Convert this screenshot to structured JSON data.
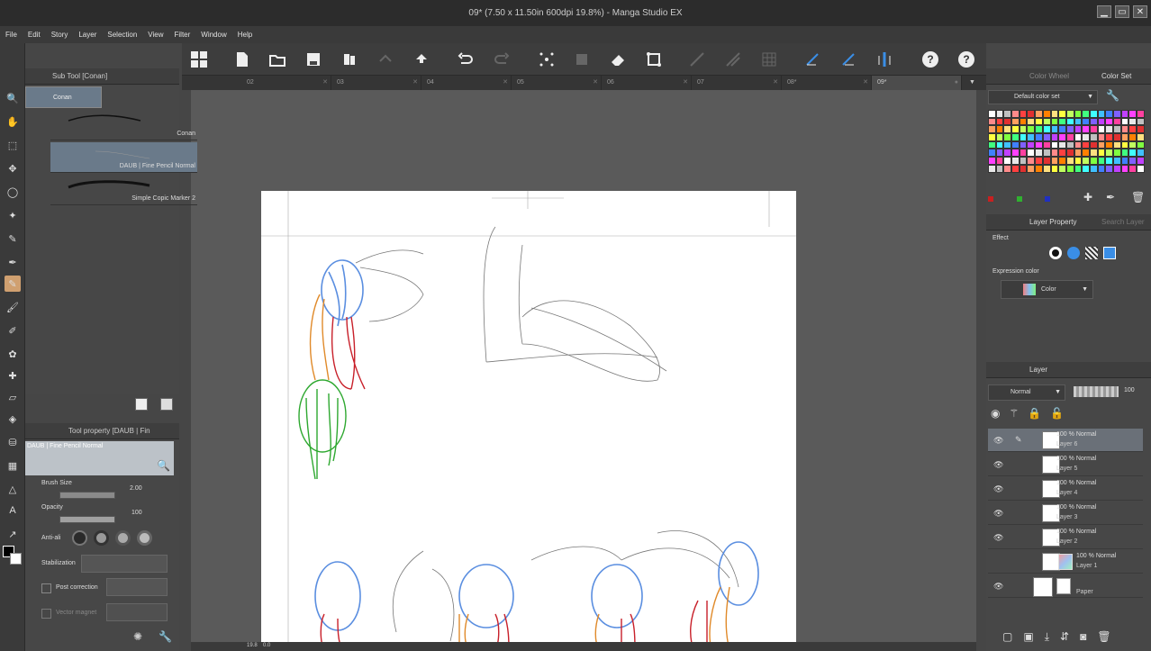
{
  "window": {
    "title": "09* (7.50 x 11.50in 600dpi 19.8%) - Manga Studio EX"
  },
  "menu": [
    "File",
    "Edit",
    "Story",
    "Layer",
    "Selection",
    "View",
    "Filter",
    "Window",
    "Help"
  ],
  "tabs": [
    {
      "label": "02"
    },
    {
      "label": "03"
    },
    {
      "label": "04"
    },
    {
      "label": "05"
    },
    {
      "label": "06"
    },
    {
      "label": "07"
    },
    {
      "label": "08*"
    },
    {
      "label": "09*",
      "active": true
    }
  ],
  "subtool": {
    "header": "Sub Tool [Conan]",
    "group": "Conan",
    "brushes": [
      {
        "name": "Conan"
      },
      {
        "name": "DAUB | Fine Pencil Normal",
        "selected": true
      },
      {
        "name": "Simple Copic Marker 2"
      }
    ]
  },
  "toolprop": {
    "header": "Tool property [DAUB | Fin",
    "brush_name": "DAUB | Fine Pencil Normal",
    "brush_size_label": "Brush Size",
    "brush_size_value": "2.00",
    "opacity_label": "Opacity",
    "opacity_value": "100",
    "antialias_label": "Anti-ali",
    "stabilization_label": "Stabilization",
    "post_correction_label": "Post correction",
    "vector_magnet_label": "Vector magnet"
  },
  "colorpanel": {
    "tab1": "Color Wheel",
    "tab2": "Color Set",
    "set_name": "Default color set"
  },
  "layerprop": {
    "tab1": "Layer Property",
    "tab2": "Search Layer",
    "effect_label": "Effect",
    "expression_label": "Expression color",
    "expression_value": "Color"
  },
  "layers": {
    "tab": "Layer",
    "blend": "Normal",
    "opacity": "100",
    "items": [
      {
        "pct": "100 %",
        "mode": "Normal",
        "name": "Layer 6",
        "selected": true
      },
      {
        "pct": "100 %",
        "mode": "Normal",
        "name": "Layer 5"
      },
      {
        "pct": "100 %",
        "mode": "Normal",
        "name": "Layer 4"
      },
      {
        "pct": "100 %",
        "mode": "Normal",
        "name": "Layer 3"
      },
      {
        "pct": "100 %",
        "mode": "Normal",
        "name": "Layer 2"
      },
      {
        "pct": "100 %",
        "mode": "Normal",
        "name": "Layer 1"
      },
      {
        "pct": "",
        "mode": "",
        "name": "Paper"
      }
    ]
  },
  "status": {
    "zoom": "19.8",
    "angle": "0.0"
  },
  "colors": {
    "accent_blue": "#3a8ee6",
    "stroke_blue": "#5a8ee0",
    "stroke_red": "#c8202a",
    "stroke_green": "#2ea830",
    "stroke_orange": "#e08a2a"
  },
  "swatch_colors": [
    "#ffffff",
    "#e8e8e8",
    "#c0c0c0",
    "#ff8a8a",
    "#ff4040",
    "#e03030",
    "#ffa060",
    "#ff8000",
    "#ffe080",
    "#ffff40",
    "#c0ff60",
    "#80ff40",
    "#40ff80",
    "#40ffff",
    "#40c0ff",
    "#4080ff",
    "#8060ff",
    "#c040ff",
    "#ff40ff",
    "#ff40a0"
  ]
}
